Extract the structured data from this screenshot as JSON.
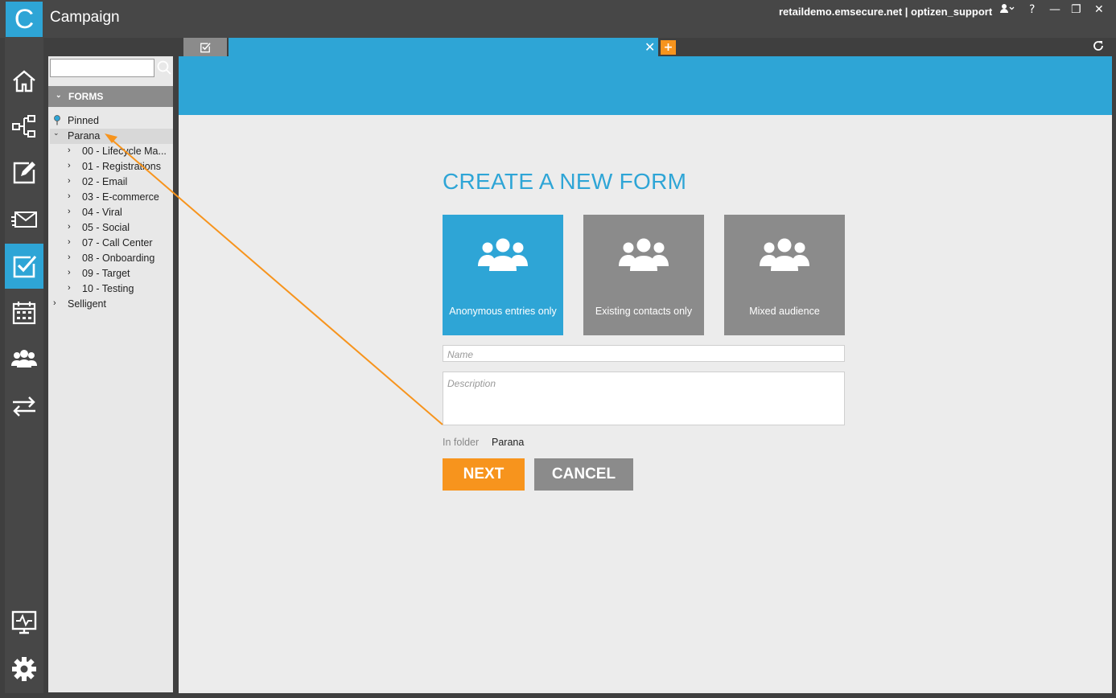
{
  "app": {
    "logo_letter": "C",
    "title": "Campaign",
    "user_info": "retaildemo.emsecure.net | optizen_support"
  },
  "window_controls": {
    "help": "?",
    "minimize": "—",
    "restore": "❐",
    "close": "✕"
  },
  "nav": [
    "home-icon",
    "journey-icon",
    "edit-icon",
    "mail-icon",
    "forms-icon",
    "calendar-icon",
    "users-icon",
    "transfer-icon",
    "monitor-icon",
    "gear-icon"
  ],
  "tree": {
    "header": "FORMS",
    "pinned": "Pinned",
    "root": "Parana",
    "children": [
      "00 - Lifecycle Ma...",
      "01 - Registrations",
      "02 - Email",
      "03 - E-commerce",
      "04 - Viral",
      "05 - Social",
      "07 - Call Center",
      "08 - Onboarding",
      "09 - Target",
      "10 - Testing"
    ],
    "other": "Selligent"
  },
  "tabs": {
    "add": "+",
    "close": "✕"
  },
  "form": {
    "heading": "CREATE A NEW FORM",
    "tiles": [
      "Anonymous entries only",
      "Existing contacts only",
      "Mixed audience"
    ],
    "selected_tile": 0,
    "name_placeholder": "Name",
    "description_placeholder": "Description",
    "folder_label": "In folder",
    "folder_value": "Parana",
    "next_label": "NEXT",
    "cancel_label": "CANCEL"
  },
  "colors": {
    "accent": "#2ea5d6",
    "orange": "#f7941d",
    "gray": "#8b8b8b"
  }
}
